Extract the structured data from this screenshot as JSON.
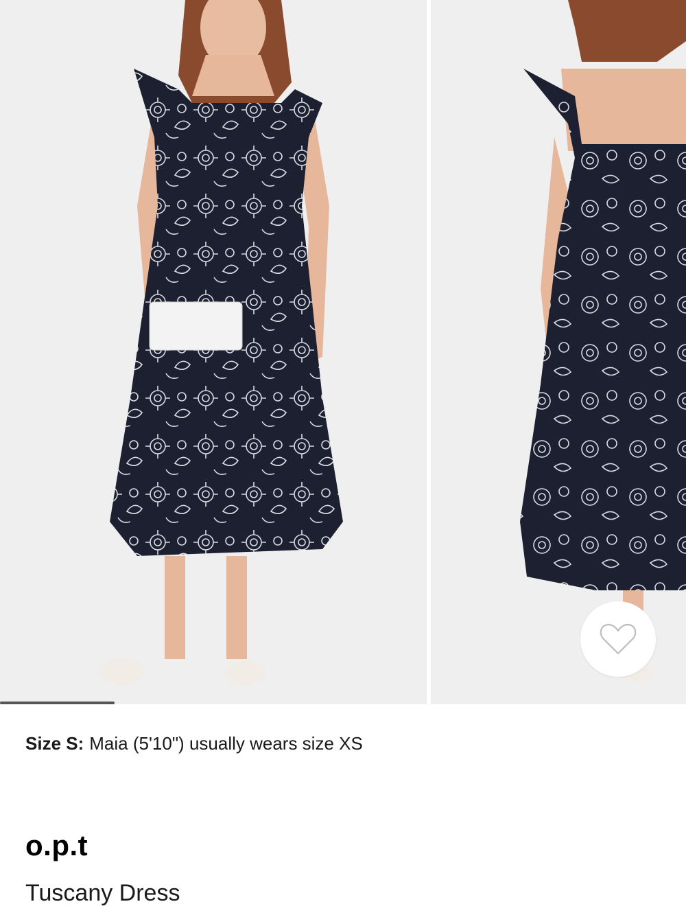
{
  "gallery": {
    "images": [
      {
        "name": "front view image"
      },
      {
        "name": "back view image"
      }
    ],
    "progress_fraction": 0.167
  },
  "favorite": {
    "icon": "heart-outline-icon"
  },
  "size_note": {
    "label": "Size S:",
    "text": "Maia (5'10\") usually wears size XS"
  },
  "product": {
    "brand": "o.p.t",
    "name": "Tuscany Dress"
  },
  "colors": {
    "dress": "#1c2030",
    "print": "#d9dce3",
    "background": "#efefef",
    "skin": "#e6b79a"
  }
}
